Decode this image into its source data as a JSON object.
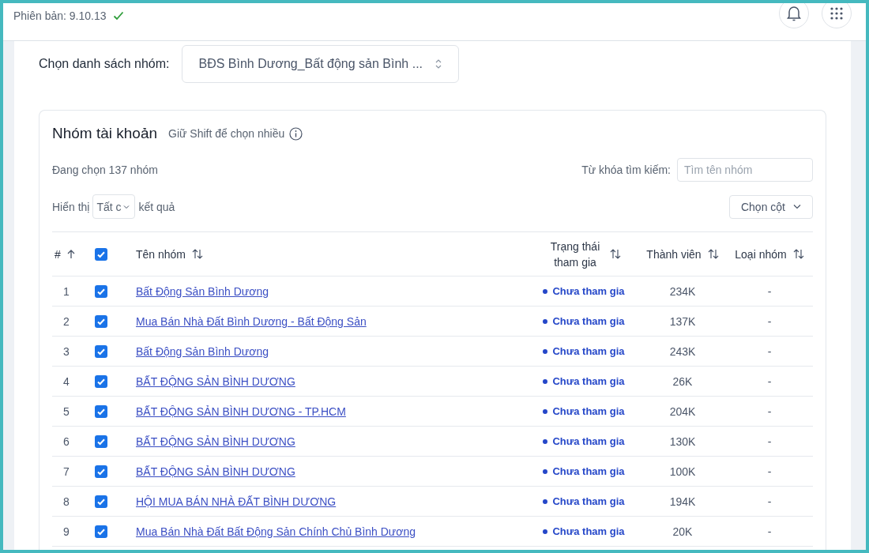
{
  "header": {
    "version": "Phiên bản: 9.10.13",
    "version_ok": true
  },
  "group_list": {
    "label": "Chọn danh sách nhóm:",
    "value": "BĐS Bình Dương_Bất động sản Bình ..."
  },
  "card": {
    "title": "Nhóm tài khoản",
    "hint": "Giữ Shift để chọn nhiều",
    "selected_count": "Đang chọn 137 nhóm",
    "search_label": "Từ khóa tìm kiếm:",
    "search_placeholder": "Tìm tên nhóm",
    "show_label": "Hiển thị",
    "show_value": "Tất c",
    "show_suffix": "kết quả",
    "columns_button": "Chọn cột"
  },
  "table": {
    "columns": [
      {
        "kind": "index",
        "label": "#",
        "sorted": true
      },
      {
        "kind": "check",
        "checked": true
      },
      {
        "kind": "name",
        "label": "Tên nhóm",
        "sorted": false
      },
      {
        "kind": "status",
        "label": "Trạng thái tham gia",
        "sorted": false
      },
      {
        "kind": "members",
        "label": "Thành viên",
        "sorted": false
      },
      {
        "kind": "type",
        "label": "Loại nhóm",
        "sorted": false
      }
    ],
    "rows": [
      {
        "index": "1",
        "checked": true,
        "name": "Bất Động Sản Bình Dương",
        "status": "Chưa tham gia",
        "color": "#2547c9",
        "members": "234K",
        "type": "-"
      },
      {
        "index": "2",
        "checked": true,
        "name": "Mua Bán Nhà Đất Bình Dương - Bất Động Sản",
        "status": "Chưa tham gia",
        "color": "#2547c9",
        "members": "137K",
        "type": "-"
      },
      {
        "index": "3",
        "checked": true,
        "name": "Bất Động Sản Bình Dương",
        "status": "Chưa tham gia",
        "color": "#2547c9",
        "members": "243K",
        "type": "-"
      },
      {
        "index": "4",
        "checked": true,
        "name": "BẤT ĐỘNG SẢN BÌNH DƯƠNG",
        "status": "Chưa tham gia",
        "color": "#2547c9",
        "members": "26K",
        "type": "-"
      },
      {
        "index": "5",
        "checked": true,
        "name": "BẤT ĐỘNG SẢN BÌNH DƯƠNG - TP.HCM",
        "status": "Chưa tham gia",
        "color": "#2547c9",
        "members": "204K",
        "type": "-"
      },
      {
        "index": "6",
        "checked": true,
        "name": "BẤT ĐỘNG SẢN BÌNH DƯƠNG",
        "status": "Chưa tham gia",
        "color": "#2547c9",
        "members": "130K",
        "type": "-"
      },
      {
        "index": "7",
        "checked": true,
        "name": "BẤT ĐỘNG SẢN BÌNH DƯƠNG",
        "status": "Chưa tham gia",
        "color": "#2547c9",
        "members": "100K",
        "type": "-"
      },
      {
        "index": "8",
        "checked": true,
        "name": "HỘI MUA BÁN NHÀ ĐẤT BÌNH DƯƠNG",
        "status": "Chưa tham gia",
        "color": "#2547c9",
        "members": "194K",
        "type": "-"
      },
      {
        "index": "9",
        "checked": true,
        "name": "Mua Bán Nhà Đất Bất Động Sản Chính Chủ Bình Dương",
        "status": "Chưa tham gia",
        "color": "#2547c9",
        "members": "20K",
        "type": "-"
      }
    ]
  }
}
